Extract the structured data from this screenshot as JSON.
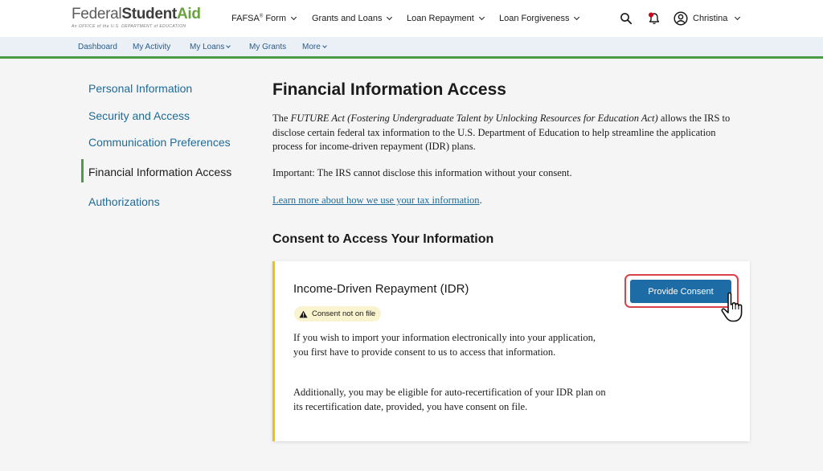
{
  "header": {
    "logo": {
      "federal": "Federal",
      "student": "Student",
      "aid": "Aid",
      "tagline": "An OFFICE of the U.S. DEPARTMENT of EDUCATION"
    },
    "nav": [
      {
        "label": "FAFSA",
        "sup": "®",
        "label2": " Form"
      },
      {
        "label": "Grants and Loans"
      },
      {
        "label": "Loan Repayment"
      },
      {
        "label": "Loan Forgiveness"
      }
    ],
    "user_name": "Christina",
    "icons": {
      "search": "search-icon",
      "notifications": "bell-icon",
      "account": "user-circle-icon"
    }
  },
  "subnav": {
    "items": [
      {
        "label": "Dashboard"
      },
      {
        "label": "My Activity"
      },
      {
        "label": "My Loans"
      },
      {
        "label": "My Grants"
      },
      {
        "label": "More"
      }
    ]
  },
  "sidebar": {
    "items": [
      {
        "label": "Personal Information"
      },
      {
        "label": "Security and Access"
      },
      {
        "label": "Communication Preferences"
      },
      {
        "label": "Financial Information Access"
      },
      {
        "label": "Authorizations"
      }
    ],
    "active_index": 3
  },
  "main": {
    "title": "Financial Information Access",
    "intro": {
      "lead": "The ",
      "act_name": "FUTURE Act (Fostering Undergraduate Talent by Unlocking Resources for Education Act)",
      "rest": " allows the IRS to disclose certain federal tax information to the U.S. Department of Education to help streamline the application process for income-driven repayment (IDR) plans."
    },
    "important": "Important: The IRS cannot disclose this information without your consent.",
    "learn_more_link": "Learn more about how we use your tax information",
    "learn_more_suffix": ".",
    "section_title": "Consent to Access Your Information",
    "card": {
      "title": "Income-Driven Repayment (IDR)",
      "badge": "Consent not on file",
      "paragraph1": "If you wish to import your information electronically into your application, you first have to provide consent to us to access that information.",
      "paragraph2": "Additionally, you may be eligible for auto-recertification of your IDR plan on its recertification date, provided, you have consent on file.",
      "button": "Provide Consent"
    }
  },
  "colors": {
    "brand_green": "#4c9b45",
    "link_blue": "#1f6a98",
    "button_blue": "#1e6ca6",
    "highlight_red": "#d9434b",
    "card_accent": "#f2c200"
  }
}
